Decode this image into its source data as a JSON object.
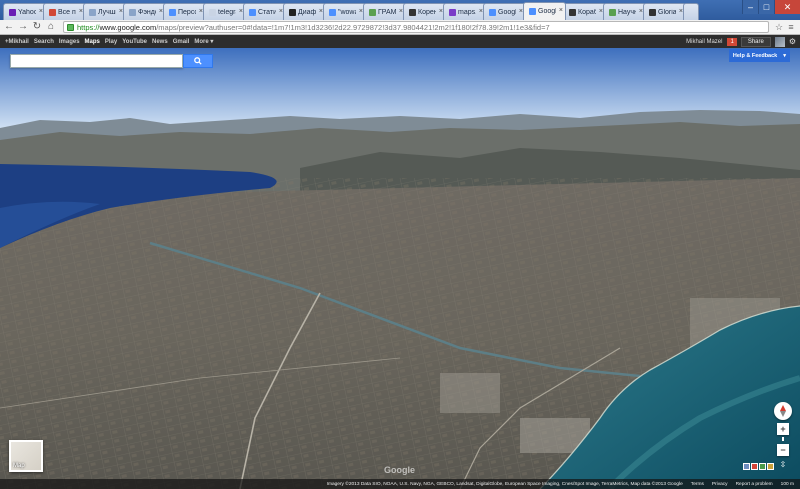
{
  "tabs": [
    {
      "title": "Yahoo!",
      "favicon_color": "#6a1eb5"
    },
    {
      "title": "Все по",
      "favicon_color": "#d14836"
    },
    {
      "title": "Лучши",
      "favicon_color": "#8aa4c8"
    },
    {
      "title": "Фэндо",
      "favicon_color": "#8aa4c8"
    },
    {
      "title": "Персо",
      "favicon_color": "#4d90fe"
    },
    {
      "title": "telegrafi",
      "favicon_color": "#c9d4e4"
    },
    {
      "title": "Статист",
      "favicon_color": "#4d90fe"
    },
    {
      "title": "Диафи",
      "favicon_color": "#222222"
    },
    {
      "title": "\"wowan",
      "favicon_color": "#4d90fe"
    },
    {
      "title": "ГРАМО",
      "favicon_color": "#5aa050"
    },
    {
      "title": "Корене",
      "favicon_color": "#333333"
    },
    {
      "title": "maps.g",
      "favicon_color": "#7a3cc8"
    },
    {
      "title": "Google",
      "favicon_color": "#4d90fe"
    },
    {
      "title": "Google",
      "favicon_color": "#4d90fe",
      "active": true
    },
    {
      "title": "Корабл",
      "favicon_color": "#333333"
    },
    {
      "title": "Научне",
      "favicon_color": "#5aa050"
    },
    {
      "title": "Gloria I",
      "favicon_color": "#333333"
    }
  ],
  "address": {
    "scheme": "https://",
    "host": "www.google.com",
    "path": "/maps/preview?authuser=0#!data=!1m7!1m3!1d3236!2d22.9729872!3d37.9804421!2m2!1f180!2f78.39!2m1!1e3&fid=7"
  },
  "gbar": {
    "links": [
      "+Mikhail",
      "Search",
      "Images",
      "Maps",
      "Play",
      "YouTube",
      "News",
      "Gmail",
      "More ▾"
    ],
    "active": "Maps",
    "user": "Mikhail Mazel",
    "notifications": "1",
    "share_label": "Share"
  },
  "help_label": "Help & Feedback",
  "minimap_label": "Map",
  "watermark": "Google",
  "attribution": "Imagery ©2013 Data SIO, NOAA, U.S. Navy, NGA, GEBCO, Landsat, DigitalGlobe, European Space Imaging, Cnes/Spot Image, TerraMetrics, Map data ©2013 Google",
  "status_links": [
    "Terms",
    "Privacy",
    "Report a problem",
    "100 m"
  ],
  "icons": {
    "search": "search-icon",
    "gear": "gear-icon",
    "compass": "compass-icon",
    "zoom_in": "+",
    "zoom_out": "−",
    "rotate": "rotate-icon"
  }
}
